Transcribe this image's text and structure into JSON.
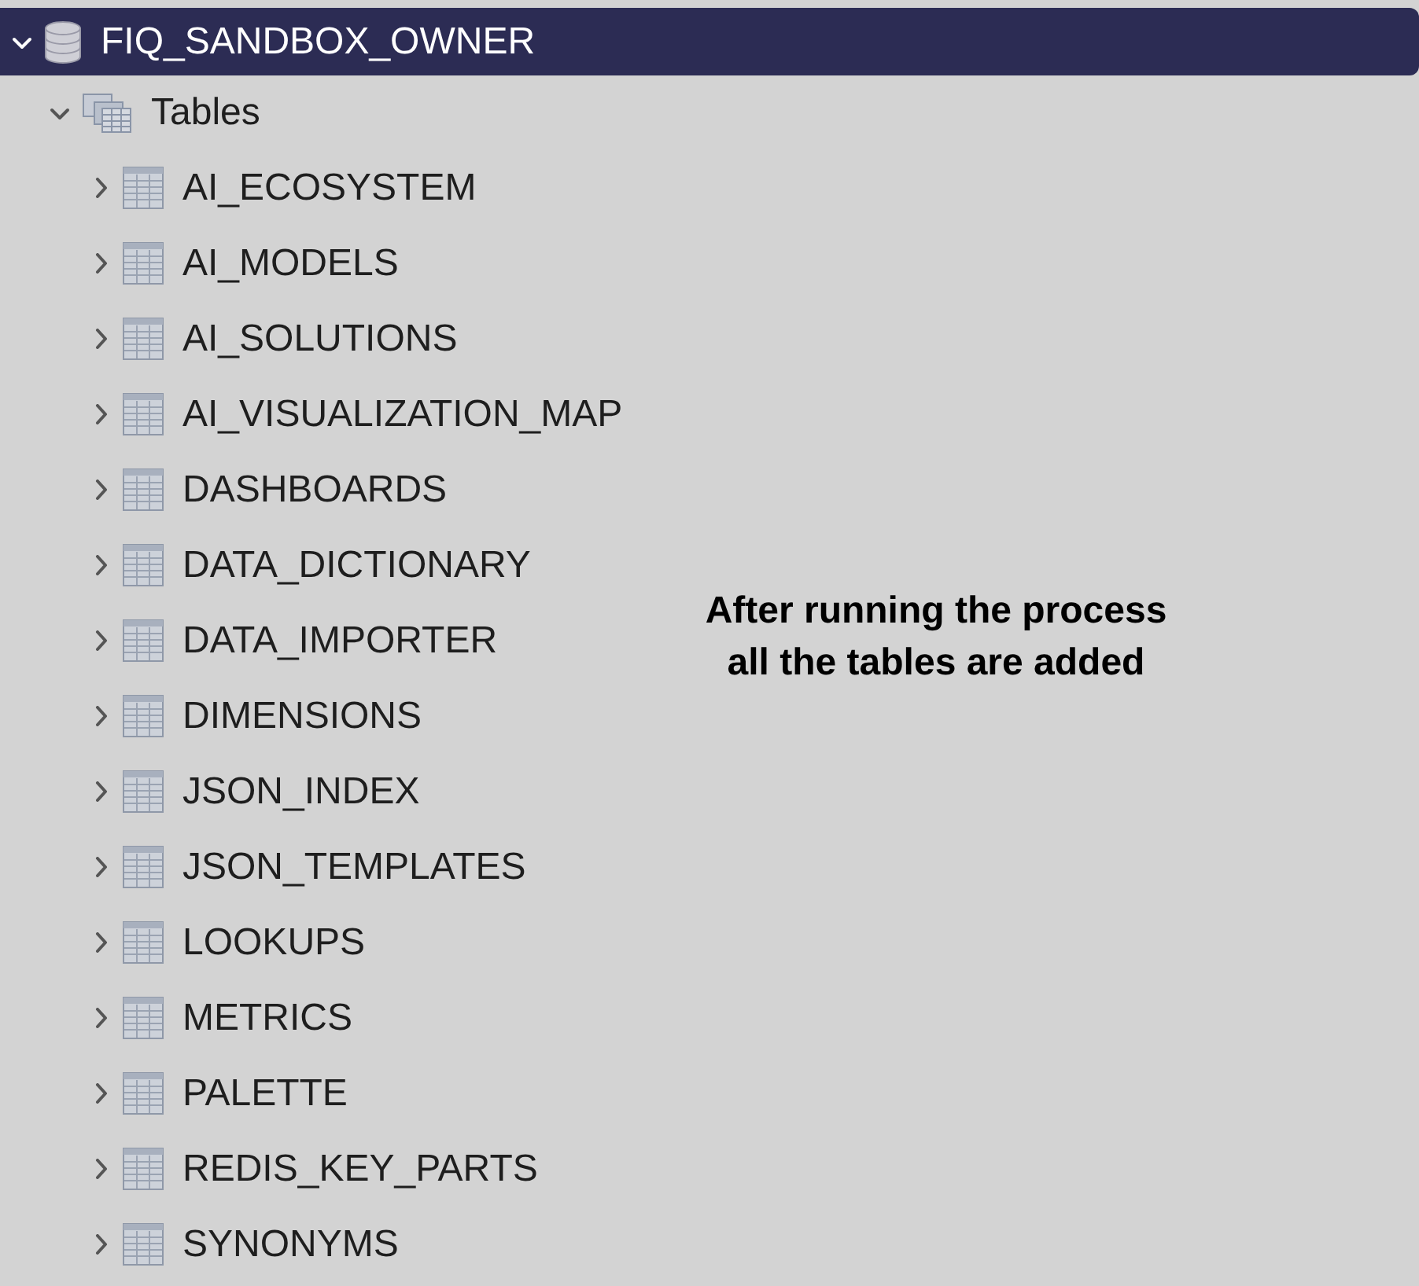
{
  "tree": [
    {
      "label": "FIQ_SANDBOX_OWNER",
      "kind": "schema",
      "expanded": true,
      "selected": true,
      "children": [
        {
          "label": "Tables",
          "kind": "folder",
          "expanded": true,
          "selected": false,
          "children": [
            {
              "label": "AI_ECOSYSTEM",
              "kind": "table",
              "expanded": false,
              "selected": false
            },
            {
              "label": "AI_MODELS",
              "kind": "table",
              "expanded": false,
              "selected": false
            },
            {
              "label": "AI_SOLUTIONS",
              "kind": "table",
              "expanded": false,
              "selected": false
            },
            {
              "label": "AI_VISUALIZATION_MAP",
              "kind": "table",
              "expanded": false,
              "selected": false
            },
            {
              "label": "DASHBOARDS",
              "kind": "table",
              "expanded": false,
              "selected": false
            },
            {
              "label": "DATA_DICTIONARY",
              "kind": "table",
              "expanded": false,
              "selected": false
            },
            {
              "label": "DATA_IMPORTER",
              "kind": "table",
              "expanded": false,
              "selected": false
            },
            {
              "label": "DIMENSIONS",
              "kind": "table",
              "expanded": false,
              "selected": false
            },
            {
              "label": "JSON_INDEX",
              "kind": "table",
              "expanded": false,
              "selected": false
            },
            {
              "label": "JSON_TEMPLATES",
              "kind": "table",
              "expanded": false,
              "selected": false
            },
            {
              "label": "LOOKUPS",
              "kind": "table",
              "expanded": false,
              "selected": false
            },
            {
              "label": "METRICS",
              "kind": "table",
              "expanded": false,
              "selected": false
            },
            {
              "label": "PALETTE",
              "kind": "table",
              "expanded": false,
              "selected": false
            },
            {
              "label": "REDIS_KEY_PARTS",
              "kind": "table",
              "expanded": false,
              "selected": false
            },
            {
              "label": "SYNONYMS",
              "kind": "table",
              "expanded": false,
              "selected": false
            }
          ]
        }
      ]
    }
  ],
  "annotation": [
    "After running the process",
    "all the tables are added"
  ]
}
